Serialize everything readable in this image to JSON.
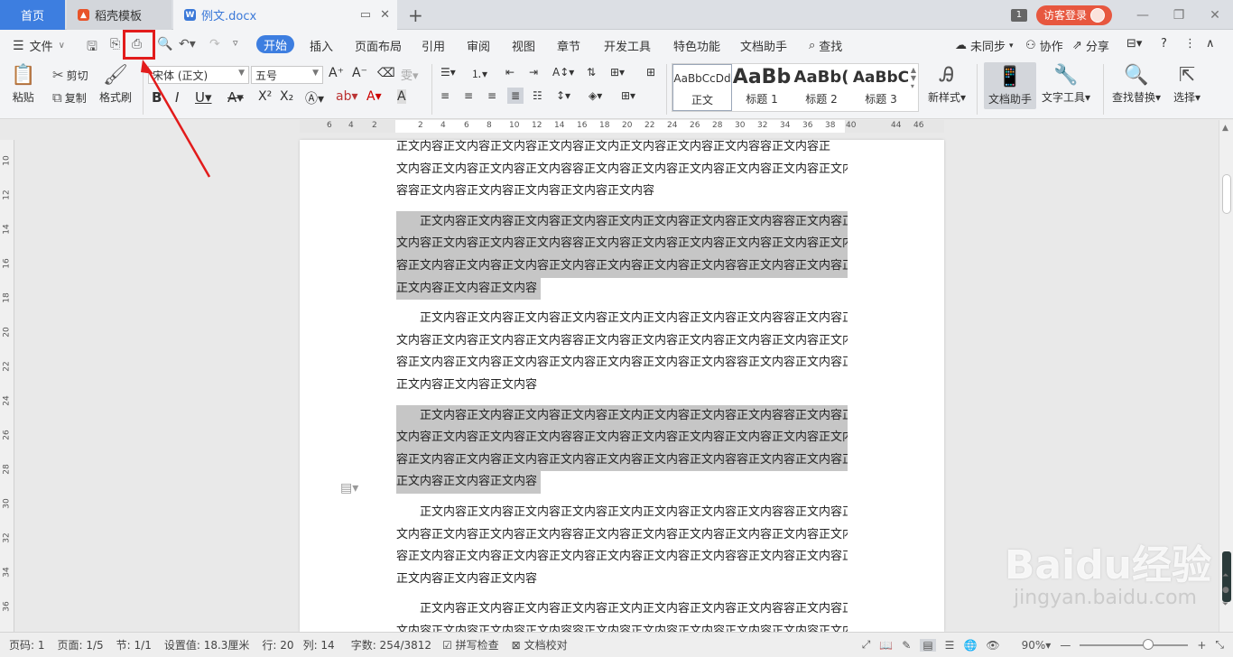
{
  "tabs": {
    "home": "首页",
    "template": "稻壳模板",
    "doc": "例文.docx",
    "window_count": "1",
    "login": "访客登录"
  },
  "menu": {
    "file": "文件",
    "tabs": [
      "开始",
      "插入",
      "页面布局",
      "引用",
      "审阅",
      "视图",
      "章节",
      "开发工具",
      "特色功能",
      "文档助手"
    ],
    "search": "查找",
    "sync": "未同步",
    "collab": "协作",
    "share": "分享"
  },
  "ribbon": {
    "paste": "粘贴",
    "cut": "剪切",
    "copy": "复制",
    "format_painter": "格式刷",
    "font_name": "宋体 (正文)",
    "font_size": "五号",
    "styles": [
      {
        "sample": "AaBbCcDd",
        "name": "正文"
      },
      {
        "sample": "AaBb",
        "name": "标题 1"
      },
      {
        "sample": "AaBb(",
        "name": "标题 2"
      },
      {
        "sample": "AaBbC",
        "name": "标题 3"
      }
    ],
    "new_style": "新样式",
    "doc_assistant": "文档助手",
    "text_tools": "文字工具",
    "find_replace": "查找替换",
    "select": "选择"
  },
  "ruler": {
    "h_ticks": [
      "6",
      "4",
      "2",
      "2",
      "4",
      "6",
      "8",
      "10",
      "12",
      "14",
      "16",
      "18",
      "20",
      "22",
      "24",
      "26",
      "28",
      "30",
      "32",
      "34",
      "36",
      "38",
      "40",
      "44",
      "46"
    ],
    "v_ticks": [
      "10",
      "12",
      "14",
      "16",
      "18",
      "20",
      "22",
      "24",
      "26",
      "28",
      "30",
      "32",
      "34",
      "36"
    ]
  },
  "document": {
    "paragraphs": [
      {
        "highlight": false,
        "lines": [
          "正文内容正文内容正文内容正文内容正文内正文内容正文内容正文内容容正文内容正",
          "文内容正文内容正文内容正文内容容正文内容正文内容正文内容正文内容正文内容正文内",
          "容容正文内容正文内容正文内容正文内容正文内容"
        ]
      },
      {
        "highlight": true,
        "lines": [
          "正文内容正文内容正文内容正文内容正文内正文内容正文内容正文内容容正文内容正",
          "文内容正文内容正文内容正文内容容正文内容正文内容正文内容正文内容正文内容正文内",
          "容正文内容正文内容正文内容正文内容正文内容正文内容正文内容容正文内容正文内容正文内容",
          "正文内容正文内容正文内容"
        ]
      },
      {
        "highlight": false,
        "lines": [
          "正文内容正文内容正文内容正文内容正文内正文内容正文内容正文内容容正文内容正",
          "文内容正文内容正文内容正文内容容正文内容正文内容正文内容正文内容正文内容正文内",
          "容正文内容正文内容正文内容正文内容正文内容正文内容正文内容容正文内容正文内容正文内容",
          "正文内容正文内容正文内容"
        ]
      },
      {
        "highlight": true,
        "lines": [
          "正文内容正文内容正文内容正文内容正文内正文内容正文内容正文内容容正文内容正",
          "文内容正文内容正文内容正文内容容正文内容正文内容正文内容正文内容正文内容正文内",
          "容正文内容正文内容正文内容正文内容正文内容正文内容正文内容容正文内容正文内容正文内容",
          "正文内容正文内容正文内容"
        ]
      },
      {
        "highlight": false,
        "lines": [
          "正文内容正文内容正文内容正文内容正文内正文内容正文内容正文内容容正文内容正",
          "文内容正文内容正文内容正文内容容正文内容正文内容正文内容正文内容正文内容正文内",
          "容正文内容正文内容正文内容正文内容正文内容正文内容正文内容容正文内容正文内容正文内容",
          "正文内容正文内容正文内容"
        ]
      },
      {
        "highlight": false,
        "lines": [
          "正文内容正文内容正文内容正文内容正文内正文内容正文内容正文内容容正文内容正",
          "文内容正文内容正文内容正文内容容正文内容正文内容正文内容正文内容正文内容正文内"
        ]
      }
    ]
  },
  "status": {
    "page_num": "页码: 1",
    "pages": "页面: 1/5",
    "section": "节: 1/1",
    "setting": "设置值: 18.3厘米",
    "row": "行: 20",
    "col": "列: 14",
    "words": "字数: 254/3812",
    "spellcheck": "拼写检查",
    "proofread": "文档校对",
    "zoom": "90%"
  },
  "watermark": {
    "brand": "Baidu经验",
    "url": "jingyan.baidu.com"
  },
  "colors": {
    "accent": "#3d7ee0",
    "login": "#e7573f",
    "annotation": "#e21b1b",
    "selection": "#c6c6c6"
  }
}
